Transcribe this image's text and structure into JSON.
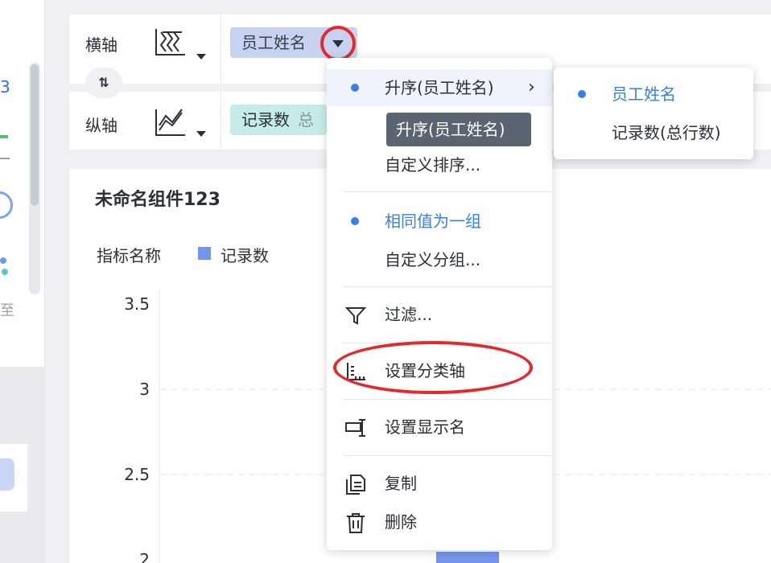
{
  "left_strip": {
    "glyph_top": "3",
    "glyph_char": "至"
  },
  "axis": {
    "x_label": "横轴",
    "y_label": "纵轴",
    "x_field": "员工姓名",
    "y_field": "记录数",
    "y_field_sub": "总"
  },
  "chart": {
    "title": "未命名组件123",
    "legend_title": "指标名称",
    "legend_series": "记录数",
    "series_color": "#7595ec"
  },
  "chart_data": {
    "type": "bar",
    "series": [
      {
        "name": "记录数"
      }
    ],
    "y_ticks": [
      "3.5",
      "3",
      "2.5",
      "2"
    ],
    "ylim": [
      2,
      3.5
    ],
    "grid": true
  },
  "menu": {
    "sort_asc": "升序(员工姓名)",
    "tooltip": "升序(员工姓名)",
    "custom_sort": "自定义排序...",
    "group_same": "相同值为一组",
    "custom_group": "自定义分组...",
    "filter": "过滤...",
    "set_category_axis": "设置分类轴",
    "set_display_name": "设置显示名",
    "copy": "复制",
    "delete": "删除"
  },
  "submenu": {
    "opt1": "员工姓名",
    "opt2": "记录数(总行数)"
  },
  "colors": {
    "accent": "#3a7ee8",
    "highlight_red": "#e4282b"
  }
}
